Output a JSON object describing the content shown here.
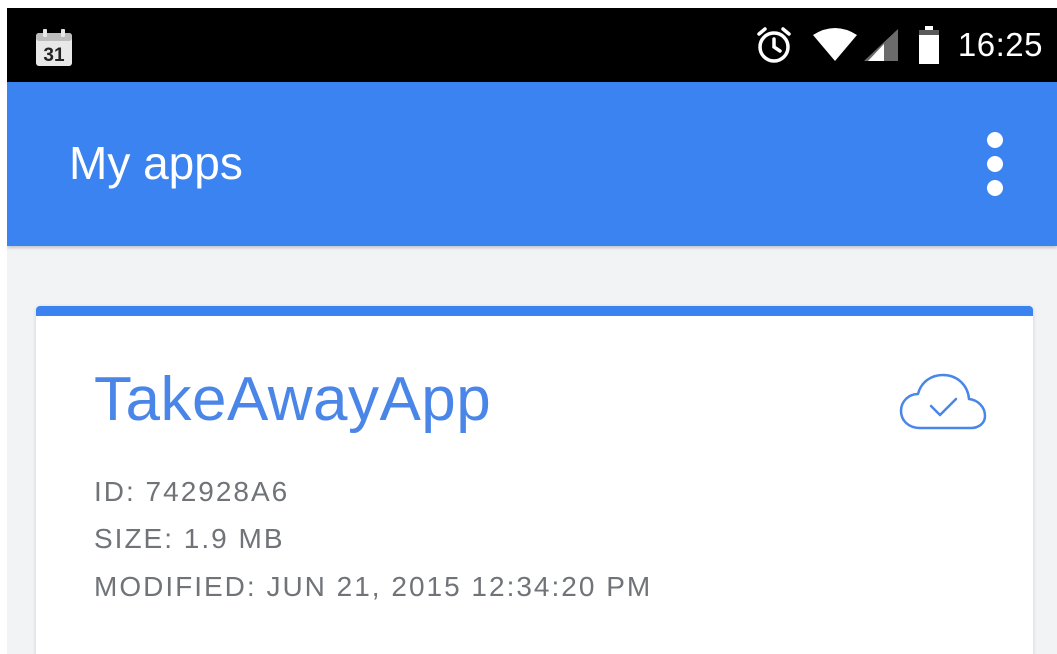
{
  "status_bar": {
    "calendar_day": "31",
    "time": "16:25",
    "icons": [
      "calendar-icon",
      "alarm-icon",
      "wifi-icon",
      "signal-icon",
      "battery-icon"
    ]
  },
  "app_bar": {
    "title": "My apps",
    "menu_icon": "more-vert-icon",
    "color": "#3b83f0"
  },
  "card": {
    "app_name": "TakeAwayApp",
    "sync_icon": "cloud-done-icon",
    "id_line": "ID: 742928A6",
    "size_line": "SIZE: 1.9 MB",
    "modified_line": "MODIFIED: JUN 21, 2015 12:34:20 PM",
    "accent_color": "#4a86e8"
  }
}
